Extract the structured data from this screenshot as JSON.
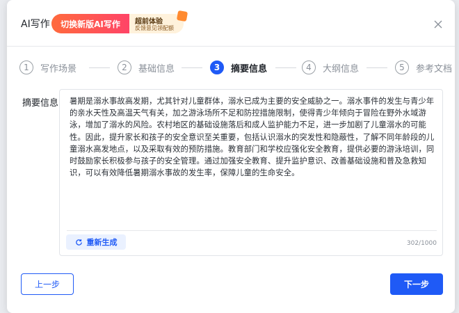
{
  "header": {
    "title": "AI写作",
    "switch_label": "切换新版AI写作",
    "promo_line1": "超前体验",
    "promo_line2": "反馈意见领配额"
  },
  "steps": [
    {
      "num": "1",
      "label": "写作场景",
      "active": false
    },
    {
      "num": "2",
      "label": "基础信息",
      "active": false
    },
    {
      "num": "3",
      "label": "摘要信息",
      "active": true
    },
    {
      "num": "4",
      "label": "大纲信息",
      "active": false
    },
    {
      "num": "5",
      "label": "参考文档",
      "active": false
    }
  ],
  "summary": {
    "label": "摘要信息",
    "text": "暑期是溺水事故高发期，尤其针对儿童群体，溺水已成为主要的安全威胁之一。溺水事件的发生与青少年的亲水天性及高温天气有关，加之游泳场所不足和防控措施限制，使得青少年倾向于冒险在野外水域游泳，增加了溺水的风险。农村地区的基础设施落后和成人监护能力不足，进一步加剧了儿童溺水的可能性。因此，提升家长和孩子的安全意识至关重要，包括认识溺水的突发性和隐蔽性，了解不同年龄段的儿童溺水高发地点，以及采取有效的预防措施。教育部门和学校应强化安全教育，提供必要的游泳培训，同时鼓励家长积极参与孩子的安全管理。通过加强安全教育、提升监护意识、改善基础设施和普及急救知识，可以有效降低暑期溺水事故的发生率，保障儿童的生命安全。",
    "regen_label": "重新生成",
    "char_count": "302/1000"
  },
  "footer": {
    "prev_label": "上一步",
    "next_label": "下一步"
  },
  "colors": {
    "accent": "#1f5af6",
    "promo_gradient_start": "#ff6a3d",
    "promo_gradient_end": "#ff4467"
  },
  "icons": {
    "close": "close-icon",
    "regenerate": "refresh-icon",
    "gift": "gift-icon"
  }
}
